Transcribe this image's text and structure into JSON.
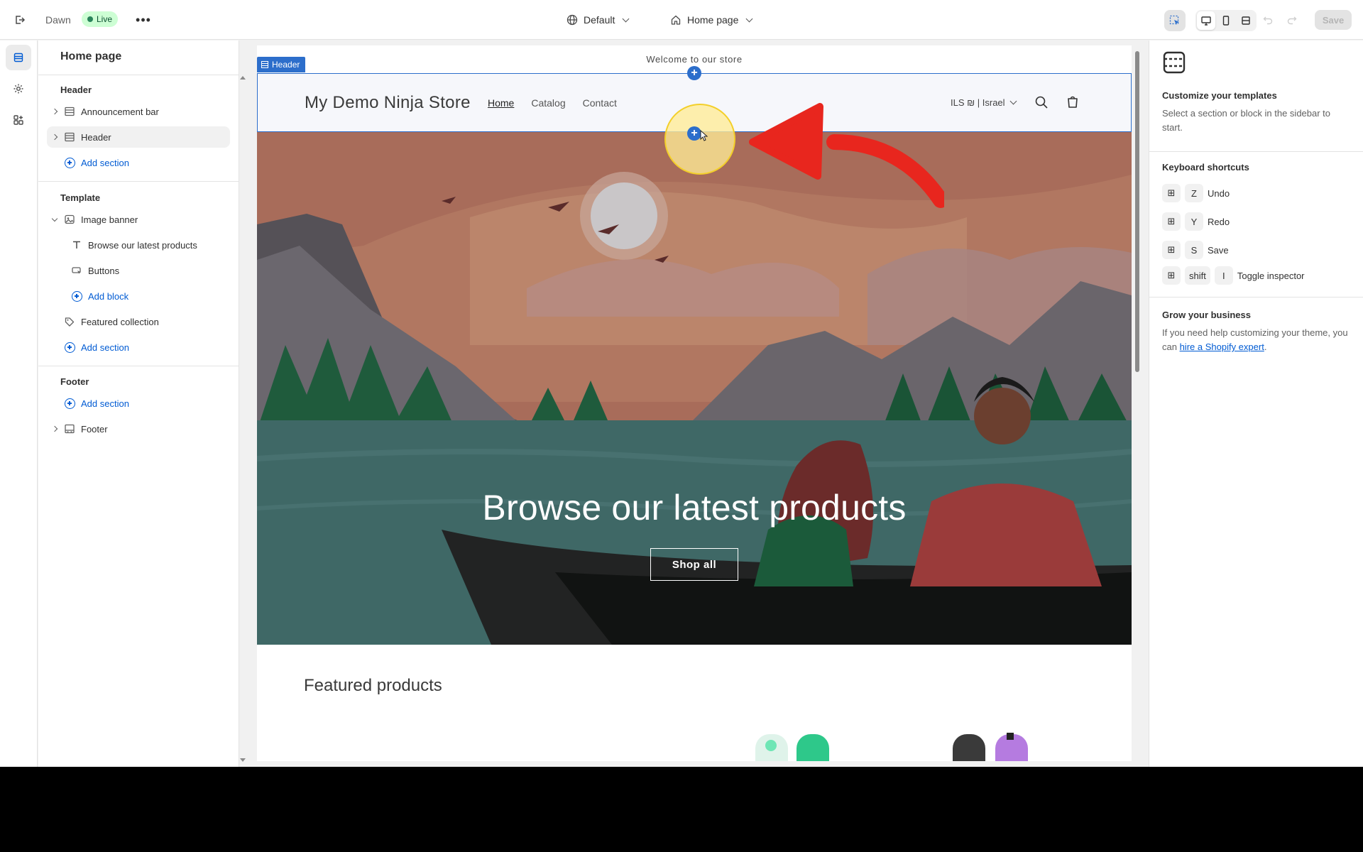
{
  "topbar": {
    "theme_name": "Dawn",
    "live_label": "Live",
    "market": "Default",
    "page": "Home page",
    "save_label": "Save"
  },
  "sidebar": {
    "title": "Home page",
    "groups": {
      "header": {
        "label": "Header",
        "items": [
          "Announcement bar",
          "Header"
        ],
        "add_label": "Add section"
      },
      "template": {
        "label": "Template",
        "image_banner": "Image banner",
        "blocks": [
          "Browse our latest products",
          "Buttons"
        ],
        "add_block_label": "Add block",
        "featured_collection": "Featured collection",
        "add_label": "Add section"
      },
      "footer": {
        "label": "Footer",
        "add_label": "Add section",
        "items": [
          "Footer"
        ]
      }
    }
  },
  "preview": {
    "announcement": "Welcome to our store",
    "header_tag": "Header",
    "store_name": "My Demo Ninja Store",
    "nav": [
      "Home",
      "Catalog",
      "Contact"
    ],
    "locale": "ILS ₪ | Israel",
    "banner_title": "Browse our latest products",
    "banner_button": "Shop all",
    "featured_title": "Featured products"
  },
  "rpanel": {
    "customize_title": "Customize your templates",
    "customize_text": "Select a section or block in the sidebar to start.",
    "shortcuts_title": "Keyboard shortcuts",
    "shortcuts": [
      {
        "keys": [
          "Z"
        ],
        "label": "Undo"
      },
      {
        "keys": [
          "Y"
        ],
        "label": "Redo"
      },
      {
        "keys": [
          "S"
        ],
        "label": "Save"
      },
      {
        "keys": [
          "shift",
          "I"
        ],
        "label": "Toggle inspector"
      }
    ],
    "grow_title": "Grow your business",
    "grow_text_before": "If you need help customizing your theme, you can ",
    "grow_link": "hire a Shopify expert",
    "grow_text_after": "."
  },
  "colors": {
    "accent": "#2c6ecb",
    "link": "#005bd3",
    "live_badge_bg": "#cdfed4",
    "arrow": "#e8261e",
    "halo": "#ffec96"
  }
}
